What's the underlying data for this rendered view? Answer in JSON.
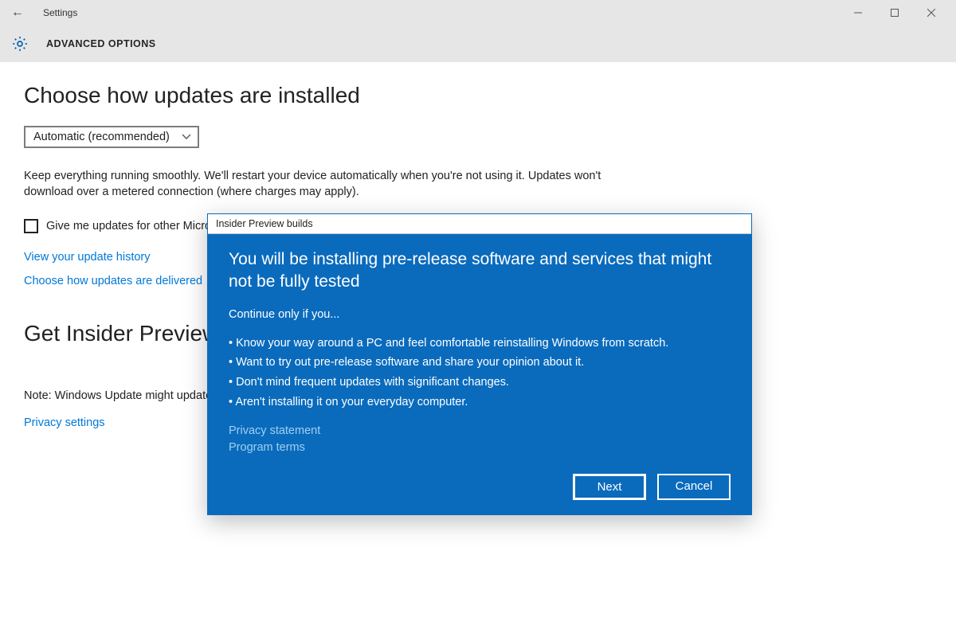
{
  "titlebar": {
    "title": "Settings"
  },
  "header": {
    "advanced_options": "ADVANCED OPTIONS"
  },
  "main": {
    "choose_heading": "Choose how updates are installed",
    "dropdown_value": "Automatic (recommended)",
    "description_1": "Keep everything running smoothly. We'll restart your device automatically when you're not using it. Updates won't download over a metered connection (where charges may apply).",
    "checkbox_label": "Give me updates for other Microsoft products when I update Windows.",
    "link_history": "View your update history",
    "link_delivered": "Choose how updates are delivered",
    "insider_heading": "Get Insider Preview builds",
    "note_text": "Note: Windows Update might update itself automatically first when checking for other updates.",
    "link_privacy_settings": "Privacy settings"
  },
  "dialog": {
    "title": "Insider Preview builds",
    "heading": "You will be installing pre-release software and services that might not be fully tested",
    "subheading": "Continue only if you...",
    "bullets": [
      "Know your way around a PC and feel comfortable reinstalling Windows from scratch.",
      "Want to try out pre-release software and share your opinion about it.",
      "Don't mind frequent updates with significant changes.",
      "Aren't installing it on your everyday computer."
    ],
    "link_privacy": "Privacy statement",
    "link_terms": "Program terms",
    "btn_next": "Next",
    "btn_cancel": "Cancel"
  }
}
